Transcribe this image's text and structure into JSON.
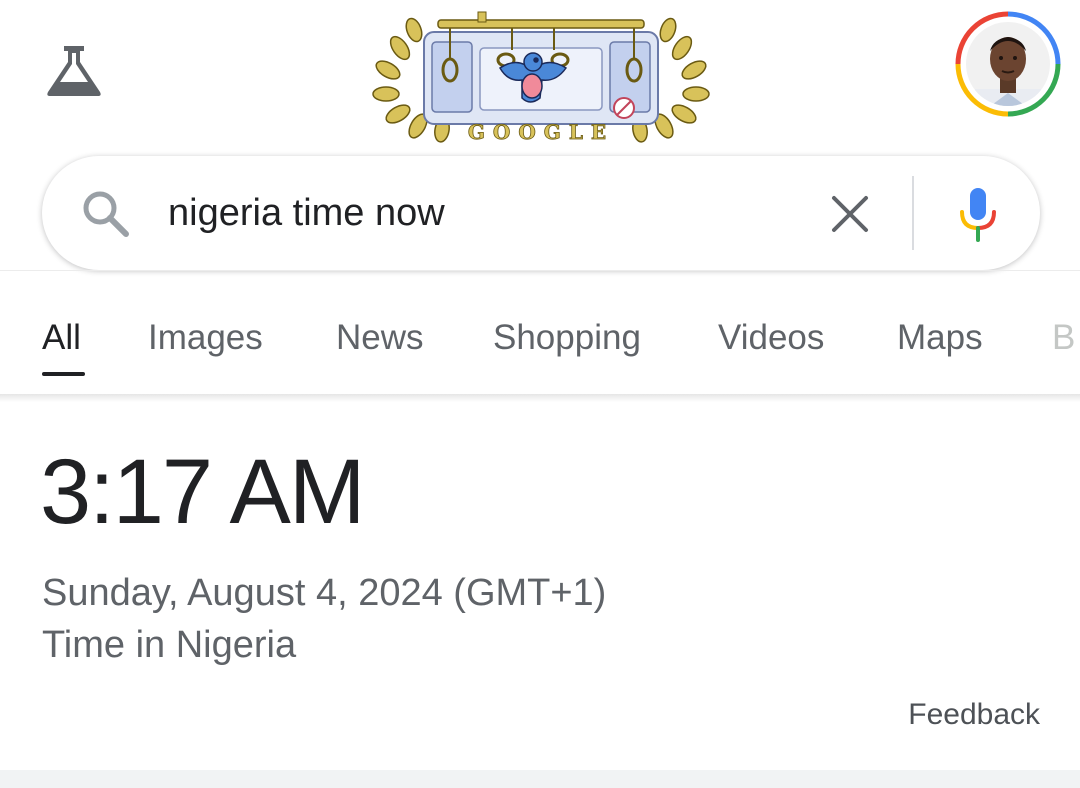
{
  "header": {
    "labs_icon": "flask-icon",
    "doodle": {
      "logo_text": "GOOGLE",
      "alt": "Google Doodle - gymnastics rings"
    },
    "avatar": {
      "icon": "profile-avatar"
    }
  },
  "search": {
    "query": "nigeria time now",
    "icons": {
      "search": "search-icon",
      "clear": "close-icon",
      "voice": "mic-icon"
    }
  },
  "tabs": {
    "items": [
      {
        "label": "All",
        "active": true
      },
      {
        "label": "Images",
        "active": false
      },
      {
        "label": "News",
        "active": false
      },
      {
        "label": "Shopping",
        "active": false
      },
      {
        "label": "Videos",
        "active": false
      },
      {
        "label": "Maps",
        "active": false
      }
    ],
    "overflow_label": "B"
  },
  "result": {
    "time": "3:17 AM",
    "date": "Sunday, August 4, 2024 (GMT+1)",
    "place": "Time in Nigeria",
    "feedback_label": "Feedback"
  },
  "colors": {
    "text_primary": "#202124",
    "text_secondary": "#5f6368",
    "google_blue": "#4285f4",
    "google_red": "#ea4335",
    "google_yellow": "#fbbc05",
    "google_green": "#34a853"
  }
}
